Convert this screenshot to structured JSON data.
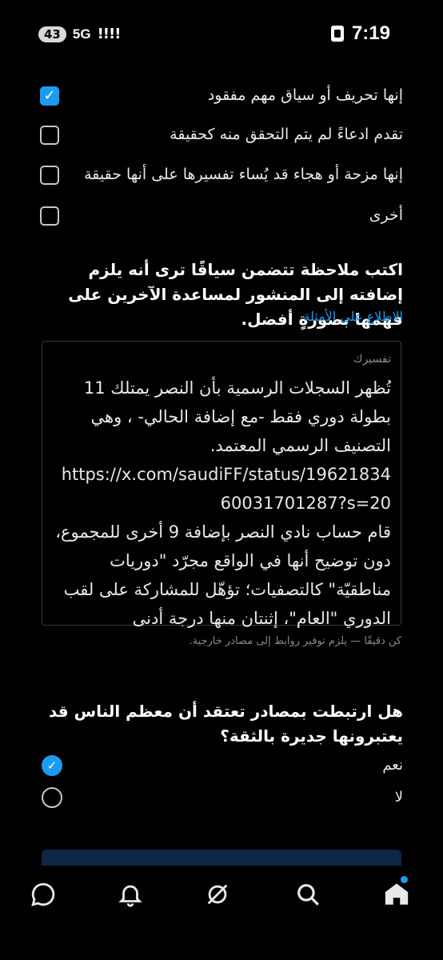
{
  "status_bar": {
    "badge": "43",
    "network": "5G",
    "signal": "!!!!",
    "time": "7:19"
  },
  "options": [
    {
      "label": "إنها تحريف أو سياق مهم مفقود",
      "checked": true
    },
    {
      "label": "تقدم ادعاءً لم يتم التحقق منه كحقيقة",
      "checked": false
    },
    {
      "label": "إنها مزحة أو هجاء قد يُساء تفسيرها على أنها حقيقة",
      "checked": false
    },
    {
      "label": "أخرى",
      "checked": false
    }
  ],
  "prompt": {
    "text": "اكتب ملاحظة تتضمن سياقًا ترى أنه يلزم إضافته إلى المنشور لمساعدة الآخرين على فهمها بصورةٍ أفضل.",
    "examples_link": "الاطلاع على الأمثلة"
  },
  "note": {
    "label": "تفسيرك",
    "text_part1": "تُظهر السجلات الرسمية بأن النصر يمتلك 11 بطولة دوري فقط -مع إضافة الحالي- ، وهي التصنيف الرسمي المعتمد.",
    "url": "https://x.com/saudiFF/status/1962183460031701287?s=20",
    "text_part2": "قام حساب نادي النصر بإضافة 9 أخرى للمجموع، دون توضيح أنها في الواقع مجرّد \"دوريات مناطقيّة\" كالتصفيات؛ تؤهّل للمشاركة على لقب الدوري \"العام\"، إثنتان منها درجة أدنى"
  },
  "helper_text": "كن دقيقًا — يلزم توفير روابط إلى مصادر خارجية.",
  "question": {
    "text": "هل ارتبطت بمصادر تعتقد أن معظم الناس قد يعتبرونها جديرة بالثقة؟",
    "answers": [
      {
        "label": "نعم",
        "selected": true
      },
      {
        "label": "لا",
        "selected": false
      }
    ]
  },
  "colors": {
    "accent": "#1d9bf0",
    "background": "#000000",
    "text": "#e7e9ea",
    "muted": "#8a8a8a"
  },
  "nav": {
    "items": [
      "chat-icon",
      "bell-icon",
      "grok-icon",
      "search-icon",
      "home-icon"
    ]
  }
}
